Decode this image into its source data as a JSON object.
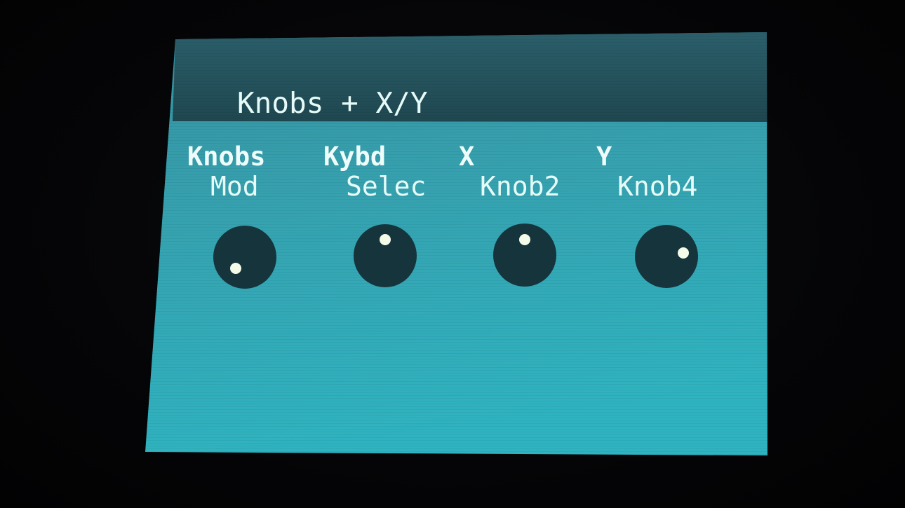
{
  "screen": {
    "title": "Knobs + X/Y"
  },
  "params": [
    {
      "label": "Knobs",
      "value": "Mod",
      "knob_pct": 0.15
    },
    {
      "label": "Kybd",
      "value": "Selec",
      "knob_pct": 0.45
    },
    {
      "label": "X",
      "value": "Knob2",
      "knob_pct": 0.5
    },
    {
      "label": "Y",
      "value": "Knob4",
      "knob_pct": 0.78
    }
  ],
  "colors": {
    "lcd_background": "#3aa6b4",
    "title_bar": "#25505a",
    "knob": "#16343b",
    "knob_indicator": "#f4fbe8",
    "text": "#e6fbf8"
  },
  "icons": [
    "knob-icon",
    "knob-indicator-dot"
  ]
}
